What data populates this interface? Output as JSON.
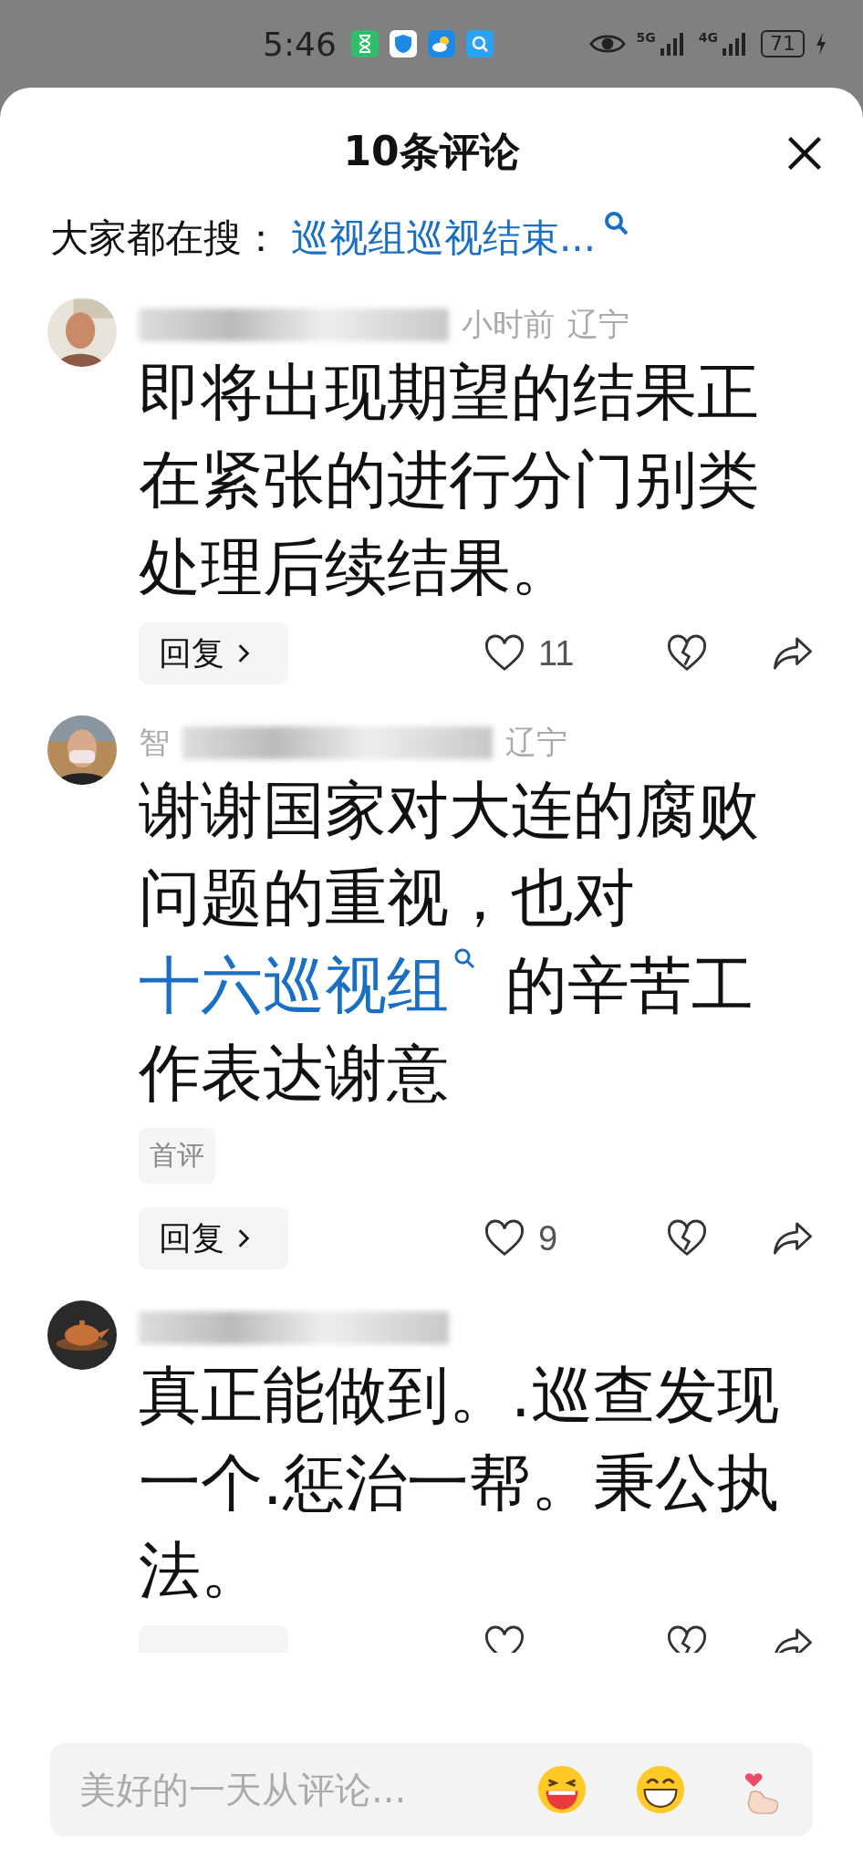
{
  "status_bar": {
    "time": "5:46",
    "signal_1": "5G",
    "signal_2": "4G",
    "battery": "71"
  },
  "header": {
    "title": "10条评论"
  },
  "trending": {
    "label": "大家都在搜：",
    "query": "巡视组巡视结束..."
  },
  "comments": [
    {
      "time": "小时前",
      "region": "辽宁",
      "body": [
        {
          "kind": "text",
          "text": "即将出现期望的结果正在紧张的进行分门别类处理后续结果。"
        }
      ],
      "reply": "回复",
      "likes": "11"
    },
    {
      "name": "智",
      "region": "辽宁",
      "body": [
        {
          "kind": "text",
          "text": "谢谢国家对大连的腐败问题的重视，也对"
        },
        {
          "kind": "link",
          "text": "十六巡视组"
        },
        {
          "kind": "text",
          "text": " 的辛苦工作表达谢意"
        }
      ],
      "tag": "首评",
      "reply": "回复",
      "likes": "9"
    },
    {
      "body": [
        {
          "kind": "text",
          "text": "真正能做到。.巡查发现一个.惩治一帮。秉公执法。"
        }
      ]
    }
  ],
  "composer": {
    "placeholder": "美好的一天从评论..."
  }
}
